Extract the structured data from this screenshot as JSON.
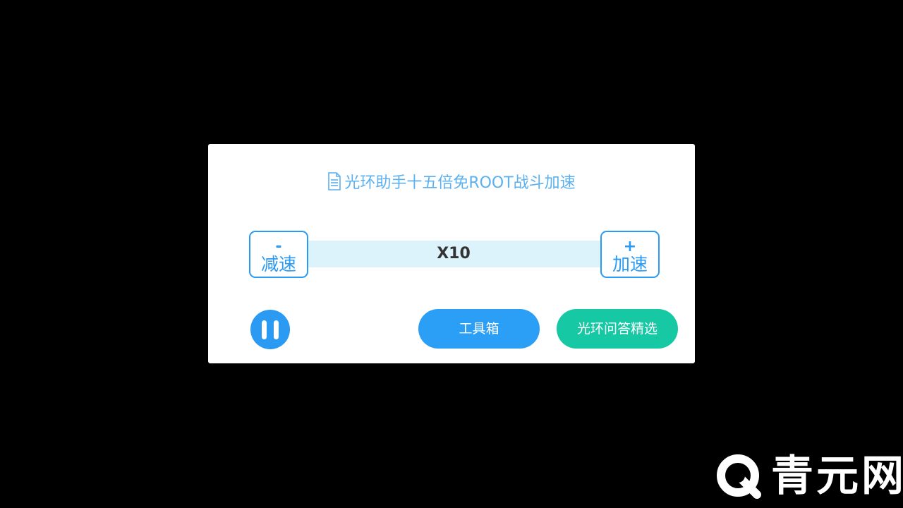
{
  "dialog": {
    "title": "光环助手十五倍免ROOT战斗加速",
    "title_icon": "document-icon",
    "speed_value": "X10",
    "minus_button": {
      "sign": "-",
      "label": "减速"
    },
    "plus_button": {
      "sign": "+",
      "label": "加速"
    },
    "pause_icon": "pause-icon",
    "toolbox_label": "工具箱",
    "qa_label": "光环问答精选"
  },
  "watermark": {
    "text": "青元网",
    "logo_icon": "q-logo-icon"
  },
  "colors": {
    "background": "#000000",
    "dialog": "#ffffff",
    "title": "#5bb0f0",
    "accent_blue": "#2b9af3",
    "speed_bar": "#dcf3fb",
    "accent_green": "#16c8a4"
  }
}
